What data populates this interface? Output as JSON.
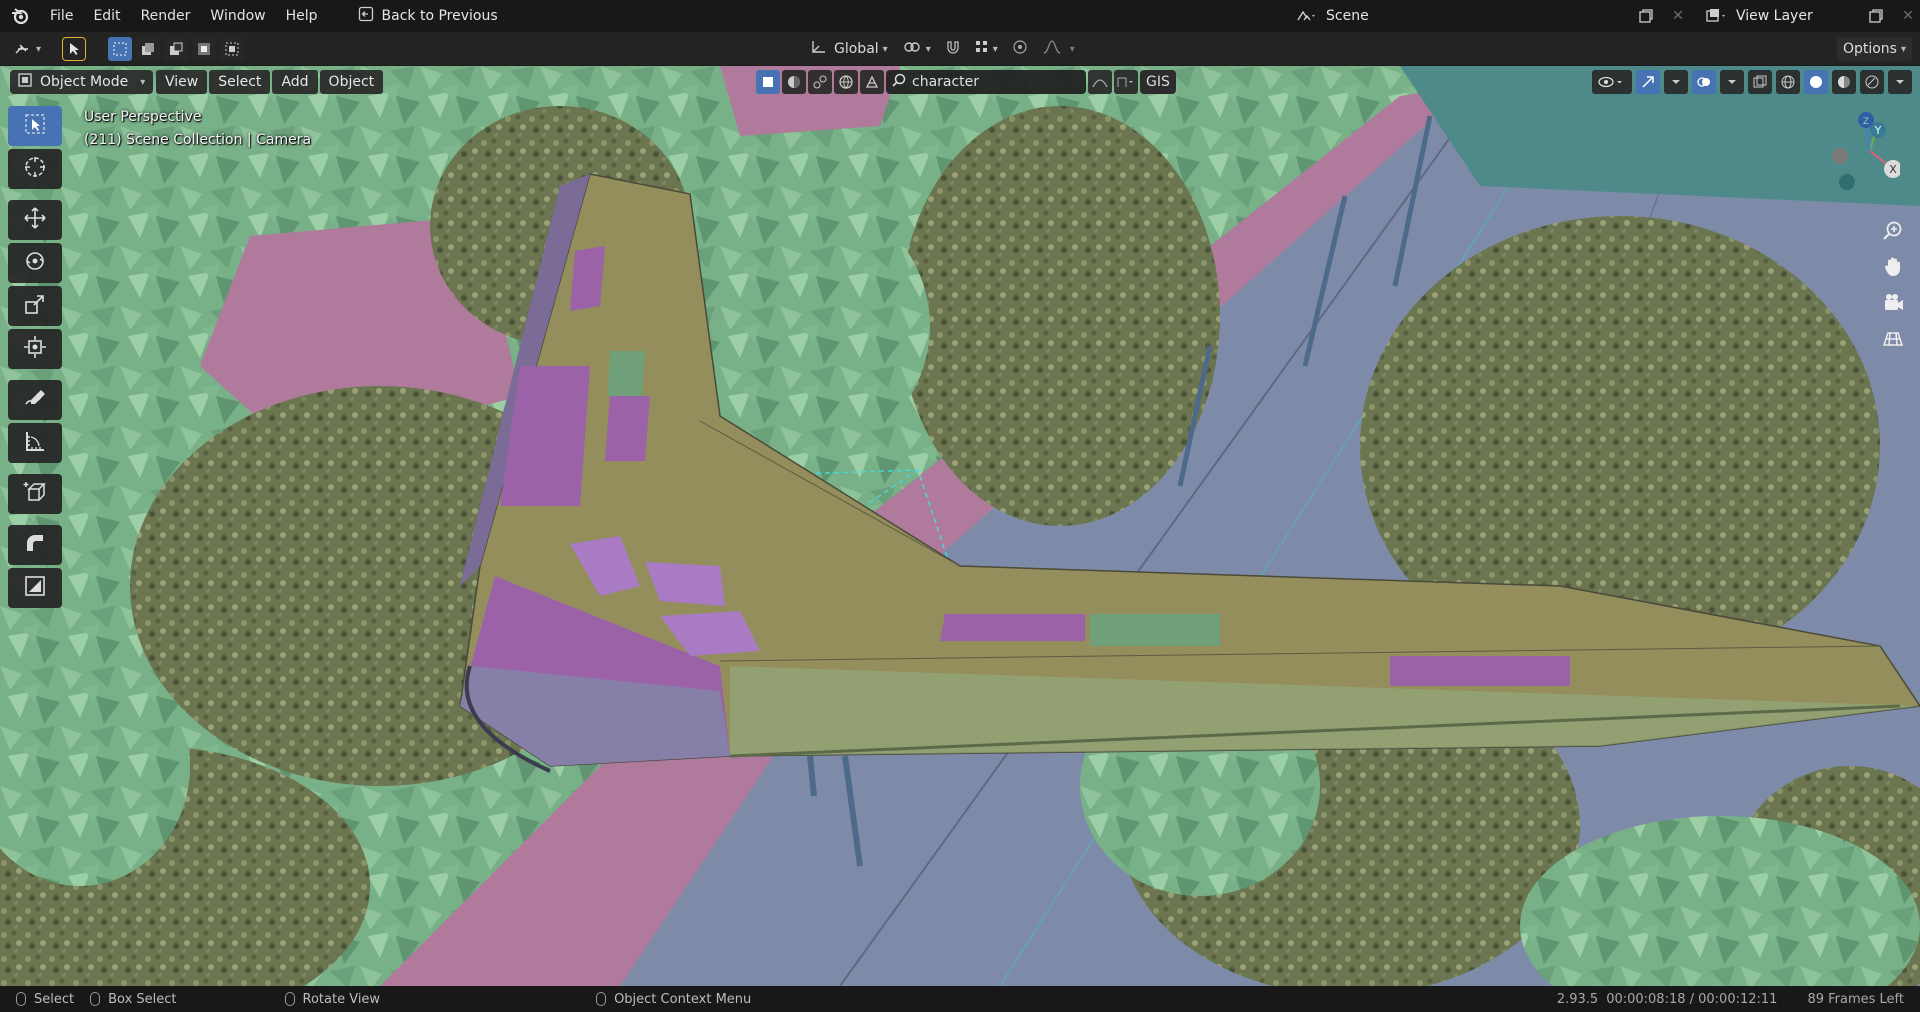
{
  "menubar": {
    "items": [
      "File",
      "Edit",
      "Render",
      "Window",
      "Help"
    ],
    "back_label": "Back to Previous",
    "scene_name": "Scene",
    "view_layer": "View Layer"
  },
  "toolheader": {
    "orientation": "Global",
    "options_label": "Options"
  },
  "viewport_header": {
    "mode": "Object Mode",
    "menus": [
      "View",
      "Select",
      "Add",
      "Object"
    ],
    "search_value": "character",
    "gis_label": "GIS"
  },
  "overlay": {
    "line1": "User Perspective",
    "line2": "(211) Scene Collection | Camera"
  },
  "toolbar": {
    "tools": [
      "select-box",
      "cursor",
      "move",
      "rotate",
      "scale",
      "transform",
      "annotate",
      "measure",
      "add-cube",
      "extrude",
      "shear"
    ],
    "active": "select-box"
  },
  "gizmo": {
    "axes": [
      "X",
      "Y",
      "Z"
    ]
  },
  "statusbar": {
    "select": "Select",
    "box_select": "Box Select",
    "rotate_view": "Rotate View",
    "context_menu": "Object Context Menu",
    "version": "2.93.5",
    "timecode": "00:00:08:18 / 00:00:12:11",
    "frames_left": "89 Frames Left"
  },
  "colors": {
    "accent": "#4772b3",
    "foliage_light": "#7fb58b",
    "foliage_dark": "#6b7a50",
    "road": "#7e8ba8",
    "sidewalk": "#b07a9c",
    "wing_purple": "#9b62a8",
    "wing_olive": "#948e5c"
  }
}
